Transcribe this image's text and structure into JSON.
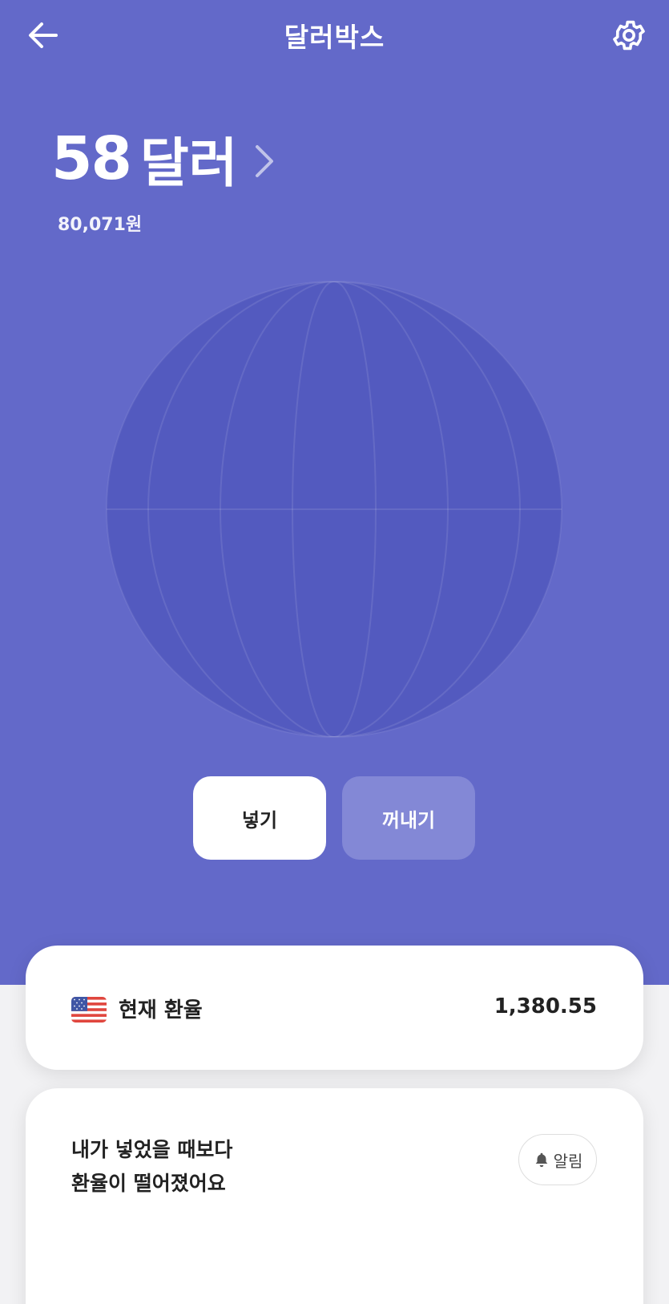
{
  "header": {
    "title": "달러박스",
    "back_icon": "arrow-left-icon",
    "settings_icon": "gear-icon"
  },
  "balance": {
    "amount": "58",
    "unit": "달러",
    "krw": "80,071원",
    "chevron_icon": "chevron-right-icon"
  },
  "actions": {
    "deposit_label": "넣기",
    "withdraw_label": "꺼내기"
  },
  "rate_card": {
    "flag_icon": "us-flag-icon",
    "label": "현재 환율",
    "value": "1,380.55"
  },
  "info_card": {
    "line1": "내가 넣었을 때보다",
    "line2": "환율이 떨어졌어요",
    "alert_label": "알림",
    "alert_icon": "bell-icon"
  },
  "colors": {
    "hero_bg": "#6369c9",
    "globe_fill": "#535abf",
    "withdraw_bg": "#8388d6"
  }
}
